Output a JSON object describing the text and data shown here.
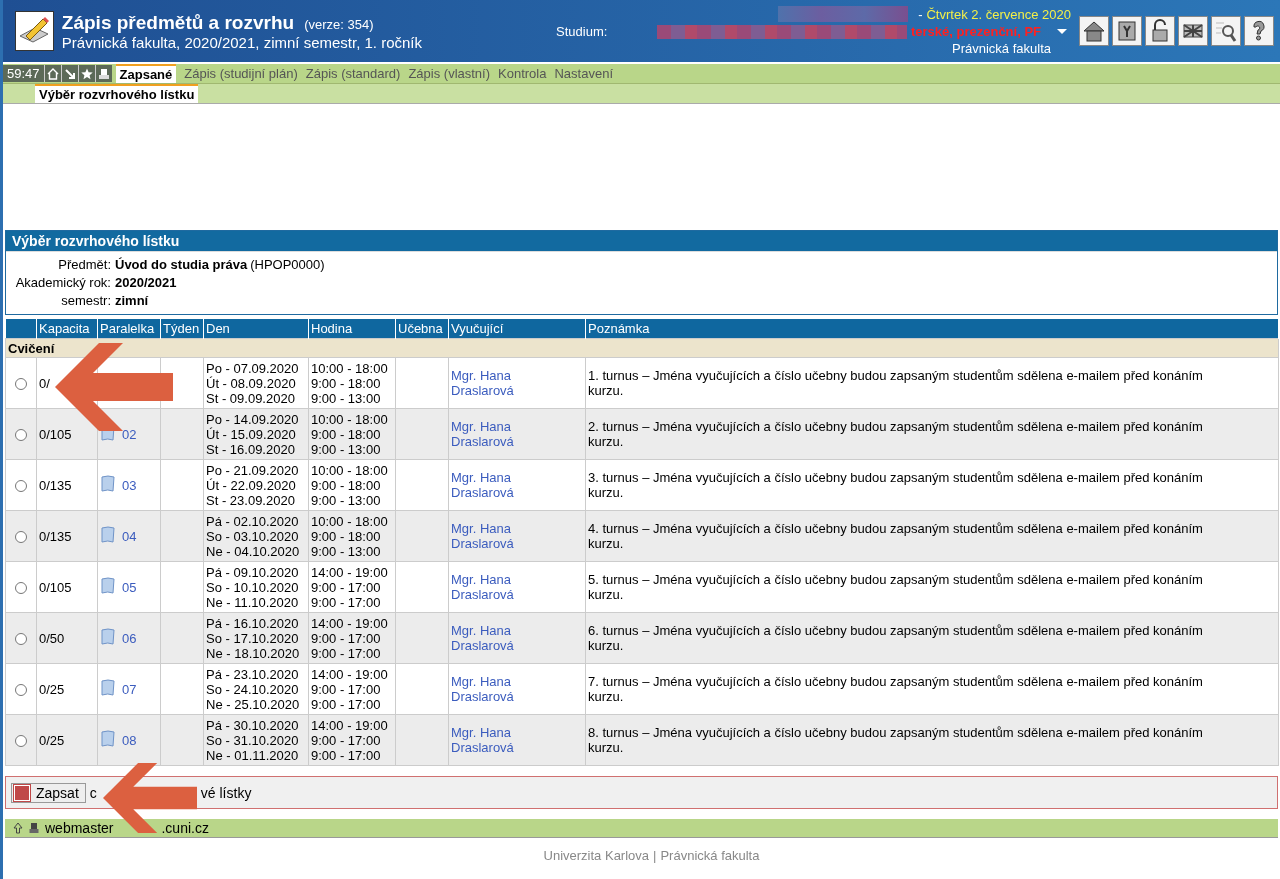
{
  "header": {
    "title": "Zápis předmětů a rozvrhu",
    "version": "(verze: 354)",
    "subtitle": "Právnická fakulta, 2020/2021, zimní semestr, 1. ročník",
    "studium_label": "Studium:",
    "date": "Čtvrtek 2. července 2020",
    "date_dash": "-",
    "study_value": "terské, prezenční, PF",
    "faculty": "Právnická fakulta"
  },
  "timer": "59:47",
  "tabs": [
    {
      "label": "Zapsané",
      "selected": true
    },
    {
      "label": "Zápis (studijní plán)",
      "selected": false
    },
    {
      "label": "Zápis (standard)",
      "selected": false
    },
    {
      "label": "Zápis (vlastní)",
      "selected": false
    },
    {
      "label": "Kontrola",
      "selected": false
    },
    {
      "label": "Nastavení",
      "selected": false
    }
  ],
  "subtabs": [
    {
      "label": "Výběr rozvrhového lístku",
      "selected": true
    }
  ],
  "panel": {
    "title": "Výběr rozvrhového lístku",
    "fields": [
      {
        "label": "Předmět:",
        "value": "Úvod do studia práva",
        "extra": "(HPOP0000)"
      },
      {
        "label": "Akademický rok:",
        "value": "2020/2021"
      },
      {
        "label": "semestr:",
        "value": "zimní"
      }
    ]
  },
  "table": {
    "columns": [
      "Kapacita",
      "Paralelka",
      "Týden",
      "Den",
      "Hodina",
      "Učebna",
      "Vyučující",
      "Poznámka"
    ],
    "group": "Cvičení",
    "rows": [
      {
        "selected": false,
        "capacity": "0/",
        "days": [
          "Po - 07.09.2020",
          "Út - 08.09.2020",
          "St - 09.09.2020"
        ],
        "hours": [
          "10:00 - 18:00",
          "9:00 - 18:00",
          "9:00 - 13:00"
        ],
        "teacher": "Mgr. Hana Draslarová",
        "note": "1. turnus – Jména vyučujících a číslo učebny budou zapsaným studentům sdělena e-mailem před konáním kurzu."
      },
      {
        "selected": false,
        "capacity": "0/105",
        "parallel": "02",
        "days": [
          "Po - 14.09.2020",
          "Út - 15.09.2020",
          "St - 16.09.2020"
        ],
        "hours": [
          "10:00 - 18:00",
          "9:00 - 18:00",
          "9:00 - 13:00"
        ],
        "teacher": "Mgr. Hana Draslarová",
        "note": "2. turnus – Jména vyučujících a číslo učebny budou zapsaným studentům sdělena e-mailem před konáním kurzu."
      },
      {
        "selected": false,
        "capacity": "0/135",
        "parallel": "03",
        "days": [
          "Po - 21.09.2020",
          "Út - 22.09.2020",
          "St - 23.09.2020"
        ],
        "hours": [
          "10:00 - 18:00",
          "9:00 - 18:00",
          "9:00 - 13:00"
        ],
        "teacher": "Mgr. Hana Draslarová",
        "note": "3. turnus – Jména vyučujících a číslo učebny budou zapsaným studentům sdělena e-mailem před konáním kurzu."
      },
      {
        "selected": false,
        "capacity": "0/135",
        "parallel": "04",
        "days": [
          "Pá - 02.10.2020",
          "So - 03.10.2020",
          "Ne - 04.10.2020"
        ],
        "hours": [
          "10:00 - 18:00",
          "9:00 - 18:00",
          "9:00 - 13:00"
        ],
        "teacher": "Mgr. Hana Draslarová",
        "note": "4. turnus – Jména vyučujících a číslo učebny budou zapsaným studentům sdělena e-mailem před konáním kurzu."
      },
      {
        "selected": false,
        "capacity": "0/105",
        "parallel": "05",
        "days": [
          "Pá - 09.10.2020",
          "So - 10.10.2020",
          "Ne - 11.10.2020"
        ],
        "hours": [
          "14:00 - 19:00",
          "9:00 - 17:00",
          "9:00 - 17:00"
        ],
        "teacher": "Mgr. Hana Draslarová",
        "note": "5. turnus – Jména vyučujících a číslo učebny budou zapsaným studentům sdělena e-mailem před konáním kurzu."
      },
      {
        "selected": false,
        "capacity": "0/50",
        "parallel": "06",
        "days": [
          "Pá - 16.10.2020",
          "So - 17.10.2020",
          "Ne - 18.10.2020"
        ],
        "hours": [
          "14:00 - 19:00",
          "9:00 - 17:00",
          "9:00 - 17:00"
        ],
        "teacher": "Mgr. Hana Draslarová",
        "note": "6. turnus – Jména vyučujících a číslo učebny budou zapsaným studentům sdělena e-mailem před konáním kurzu."
      },
      {
        "selected": false,
        "capacity": "0/25",
        "parallel": "07",
        "days": [
          "Pá - 23.10.2020",
          "So - 24.10.2020",
          "Ne - 25.10.2020"
        ],
        "hours": [
          "14:00 - 19:00",
          "9:00 - 17:00",
          "9:00 - 17:00"
        ],
        "teacher": "Mgr. Hana Draslarová",
        "note": "7. turnus – Jména vyučujících a číslo učebny budou zapsaným studentům sdělena e-mailem před konáním kurzu."
      },
      {
        "selected": false,
        "capacity": "0/25",
        "parallel": "08",
        "days": [
          "Pá - 30.10.2020",
          "So - 31.10.2020",
          "Ne - 01.11.2020"
        ],
        "hours": [
          "14:00 - 19:00",
          "9:00 - 17:00",
          "9:00 - 17:00"
        ],
        "teacher": "Mgr. Hana Draslarová",
        "note": "8. turnus – Jména vyučujících a číslo učebny budou zapsaným studentům sdělena e-mailem před konáním kurzu."
      }
    ]
  },
  "action": {
    "button": "Zapsat",
    "text_before": "c",
    "text_after": "vé lístky"
  },
  "footer": {
    "email_start": "webmaster",
    "email_end": ".cuni.cz",
    "links": [
      "Univerzita Karlova",
      "Právnická fakulta"
    ],
    "separator": "|"
  }
}
